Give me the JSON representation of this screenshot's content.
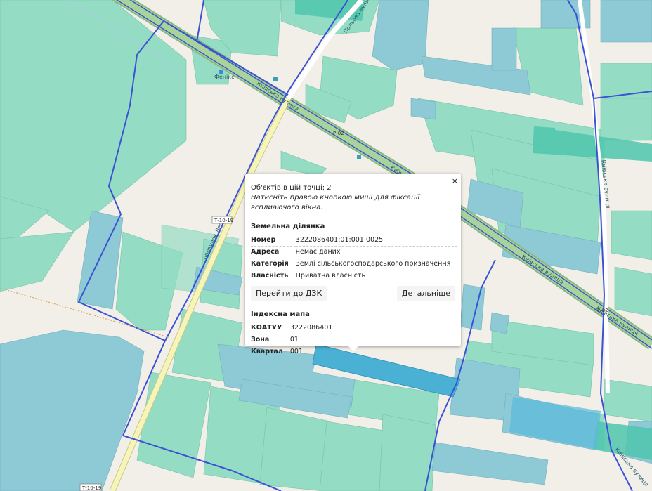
{
  "map": {
    "street_labels": [
      "Київська вулиця",
      "Київська вулиця",
      "Київська вулиця",
      "Київська вулиця",
      "Польова вулиця",
      "провулок Лесі",
      "Київська вулиця"
    ],
    "place_labels": [
      "Фенікс"
    ],
    "road_refs": [
      "Т-10-19",
      "Т-10-19",
      "Р-02",
      "Р-02"
    ],
    "colors": {
      "background": "#f2efe9",
      "parcel_green": "#8fdcc2",
      "parcel_blue": "#8ec9d6",
      "parcel_selected": "#4ab0d4",
      "boundary": "#3a52d4",
      "main_road": "#a8d49a",
      "secondary_road": "#f6f4b6"
    }
  },
  "popup": {
    "close": "×",
    "objects_count": "Об'єктів в цій точці: 2",
    "hint": "Натисніть правою кнопкою миші для фіксації всплиаючого вікна.",
    "land_parcel": {
      "title": "Земельна ділянка",
      "rows": [
        {
          "key": "Номер",
          "value": "3222086401:01:001:0025"
        },
        {
          "key": "Адреса",
          "value": "немає даних"
        },
        {
          "key": "Категорія",
          "value": "Землі сільськогосподарського призначення"
        },
        {
          "key": "Власність",
          "value": "Приватна власність"
        }
      ],
      "goto_button": "Перейти до ДЗК",
      "details_button": "Детальніше"
    },
    "index_map": {
      "title": "Індексна мапа",
      "rows": [
        {
          "key": "КОАТУУ",
          "value": "3222086401"
        },
        {
          "key": "Зона",
          "value": "01"
        },
        {
          "key": "Квартал",
          "value": "001"
        }
      ]
    }
  }
}
